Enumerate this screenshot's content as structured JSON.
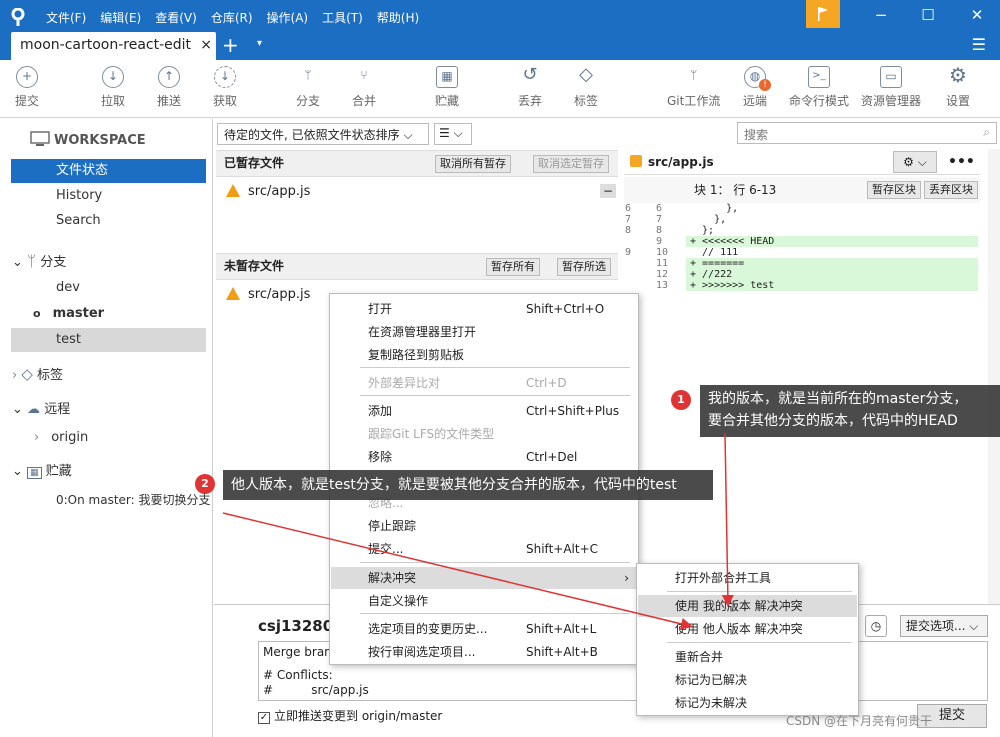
{
  "menu": [
    "文件(F)",
    "编辑(E)",
    "查看(V)",
    "仓库(R)",
    "操作(A)",
    "工具(T)",
    "帮助(H)"
  ],
  "tab": {
    "title": "moon-cartoon-react-edit",
    "close": "×",
    "plus": "+",
    "down": "▾"
  },
  "window": {
    "min": "−",
    "max": "☐",
    "close": "✕",
    "hamburger": "☰"
  },
  "toolbar": [
    {
      "label": "提交",
      "icon": "plus-icon",
      "glyph": "+"
    },
    {
      "label": "拉取",
      "icon": "arrow-down-icon",
      "glyph": "↓"
    },
    {
      "label": "推送",
      "icon": "arrow-up-icon",
      "glyph": "↑"
    },
    {
      "label": "获取",
      "icon": "fetch-icon",
      "glyph": "↓"
    },
    {
      "label": "分支",
      "icon": "branch-icon",
      "glyph": "ᛘ"
    },
    {
      "label": "合并",
      "icon": "merge-icon",
      "glyph": "⑂"
    },
    {
      "label": "贮藏",
      "icon": "stash-icon",
      "glyph": "▦"
    },
    {
      "label": "丢弃",
      "icon": "discard-icon",
      "glyph": "↺"
    },
    {
      "label": "标签",
      "icon": "tag-icon",
      "glyph": "◇"
    },
    {
      "label": "Git工作流",
      "icon": "gitflow-icon",
      "glyph": "ᛘ"
    },
    {
      "label": "远端",
      "icon": "globe-icon",
      "glyph": "◍"
    },
    {
      "label": "命令行模式",
      "icon": "terminal-icon",
      "glyph": ">_"
    },
    {
      "label": "资源管理器",
      "icon": "folder-icon",
      "glyph": "▭"
    },
    {
      "label": "设置",
      "icon": "gear-icon",
      "glyph": "⚙"
    }
  ],
  "sidebar": {
    "workspace": "WORKSPACE",
    "file_status": "文件状态",
    "history": "History",
    "search": "Search",
    "branches_title": "分支",
    "branches": [
      "dev",
      "master",
      "test"
    ],
    "tags_title": "标签",
    "remotes_title": "远程",
    "remote_origin": "origin",
    "stash_title": "贮藏",
    "stash_item": "0:On master: 我要切换分支"
  },
  "filter": {
    "label": "待定的文件, 已依照文件状态排序 ⌵",
    "view": "☰ ⌵",
    "search_placeholder": "搜索"
  },
  "staged": {
    "title": "已暂存文件",
    "unstage_all": "取消所有暂存",
    "unstage_selected": "取消选定暂存",
    "file": "src/app.js"
  },
  "unstaged": {
    "title": "未暂存文件",
    "stage_all": "暂存所有",
    "stage_selected": "暂存所选",
    "file": "src/app.js"
  },
  "diff": {
    "file": "src/app.js",
    "hunk": "块 1： 行 6-13",
    "stage_hunk": "暂存区块",
    "discard_hunk": "丢弃区块",
    "lines": [
      {
        "a": "6",
        "b": "6",
        "text": "      },",
        "add": false
      },
      {
        "a": "7",
        "b": "7",
        "text": "    },",
        "add": false
      },
      {
        "a": "8",
        "b": "8",
        "text": "  };",
        "add": false
      },
      {
        "a": "",
        "b": "9",
        "text": "+ <<<<<<< HEAD",
        "add": true
      },
      {
        "a": "9",
        "b": "10",
        "text": "  // 111",
        "add": false
      },
      {
        "a": "",
        "b": "11",
        "text": "+ =======",
        "add": true
      },
      {
        "a": "",
        "b": "12",
        "text": "+ //222",
        "add": true
      },
      {
        "a": "",
        "b": "13",
        "text": "+ >>>>>>> test",
        "add": true
      }
    ]
  },
  "context_menu": [
    {
      "label": "打开",
      "shortcut": "Shift+Ctrl+O",
      "disabled": false
    },
    {
      "label": "在资源管理器里打开",
      "shortcut": "",
      "disabled": false
    },
    {
      "label": "复制路径到剪贴板",
      "shortcut": "",
      "disabled": false
    },
    {
      "label": "外部差异比对",
      "shortcut": "Ctrl+D",
      "disabled": true
    },
    {
      "label": "添加",
      "shortcut": "Ctrl+Shift+Plus",
      "disabled": false
    },
    {
      "label": "跟踪Git LFS的文件类型",
      "shortcut": "",
      "disabled": true
    },
    {
      "label": "移除",
      "shortcut": "Ctrl+Del",
      "disabled": false
    },
    {
      "label": "忽略...",
      "shortcut": "",
      "disabled": true
    },
    {
      "label": "停止跟踪",
      "shortcut": "",
      "disabled": false
    },
    {
      "label": "提交...",
      "shortcut": "Shift+Alt+C",
      "disabled": false
    },
    {
      "label": "解决冲突",
      "shortcut": "",
      "disabled": false
    },
    {
      "label": "自定义操作",
      "shortcut": "",
      "disabled": false
    },
    {
      "label": "选定项目的变更历史...",
      "shortcut": "Shift+Alt+L",
      "disabled": false
    },
    {
      "label": "按行审阅选定项目...",
      "shortcut": "Shift+Alt+B",
      "disabled": false
    }
  ],
  "submenu": [
    "打开外部合并工具",
    "使用 我的版本 解决冲突",
    "使用 他人版本 解决冲突",
    "重新合并",
    "标记为已解决",
    "标记为未解决"
  ],
  "callouts": {
    "one_badge": "1",
    "one_line1": "我的版本，就是当前所在的master分支，",
    "one_line2": "要合并其他分支的版本，代码中的HEAD",
    "two_badge": "2",
    "two_text": "他人版本，就是test分支，就是要被其他分支合并的版本，代码中的test"
  },
  "commit": {
    "author": "csj132805",
    "options": "提交选项... ⌵",
    "message": "Merge branc",
    "conflicts": "# Conflicts:",
    "conflict_file": "#          src/app.js",
    "push_checkbox": "立即推送变更到 origin/master",
    "commit_button": "提交"
  },
  "watermark": "CSDN @在下月亮有何贵干",
  "colors": {
    "accent": "#1b6ec2",
    "warning": "#f39c12",
    "badge": "#e03333"
  }
}
